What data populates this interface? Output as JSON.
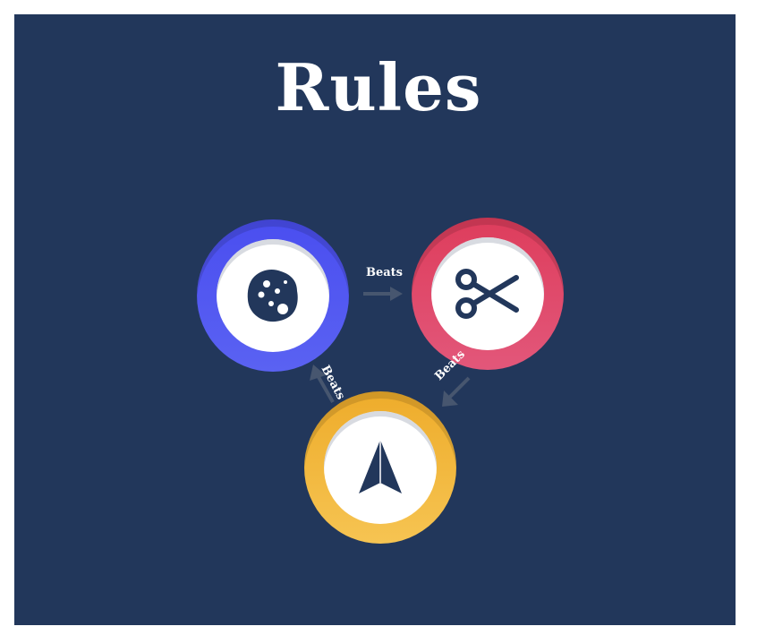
{
  "title": "Rules",
  "colors": {
    "background": "#22375b",
    "rock": "#4a4ef0",
    "scissors": "#de3d5c",
    "paper": "#eeac2b",
    "icon": "#22375b",
    "arrow": "#47566f"
  },
  "choices": [
    {
      "id": "rock",
      "icon": "rock-icon"
    },
    {
      "id": "scissors",
      "icon": "scissors-icon"
    },
    {
      "id": "paper",
      "icon": "paper-icon"
    }
  ],
  "relations": [
    {
      "from": "rock",
      "to": "scissors",
      "label": "Beats"
    },
    {
      "from": "scissors",
      "to": "paper",
      "label": "Beats"
    },
    {
      "from": "paper",
      "to": "rock",
      "label": "Beats"
    }
  ]
}
